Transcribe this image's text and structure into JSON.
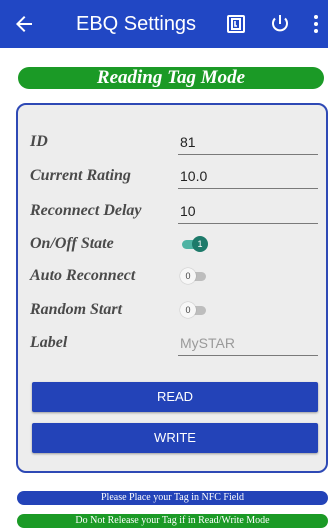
{
  "appbar": {
    "title": "EBQ Settings",
    "background": "#2147c4",
    "back_icon": "arrow-left-icon",
    "actions": [
      "nfc-icon",
      "power-icon",
      "more-vert-icon"
    ]
  },
  "mode_banner": {
    "text": "Reading Tag Mode",
    "color": "#1b9a26"
  },
  "form": {
    "id": {
      "label": "ID",
      "value": "81"
    },
    "current_rating": {
      "label": "Current Rating",
      "value": "10.0"
    },
    "reconnect_delay": {
      "label": "Reconnect Delay",
      "value": "10"
    },
    "on_off_state": {
      "label": "On/Off State",
      "state": "on",
      "thumb": "1"
    },
    "auto_reconnect": {
      "label": "Auto Reconnect",
      "state": "off",
      "thumb": "0"
    },
    "random_start": {
      "label": "Random Start",
      "state": "off",
      "thumb": "0"
    },
    "label": {
      "label": "Label",
      "value": "",
      "placeholder": "MySTAR"
    }
  },
  "buttons": {
    "read": "READ",
    "write": "WRITE",
    "color": "#2343b8"
  },
  "notices": [
    {
      "text": "Please Place your Tag in NFC Field",
      "color": "#2343b8"
    },
    {
      "text": "Do Not Release your Tag if in Read/Write Mode",
      "color": "#1b9a26"
    }
  ]
}
